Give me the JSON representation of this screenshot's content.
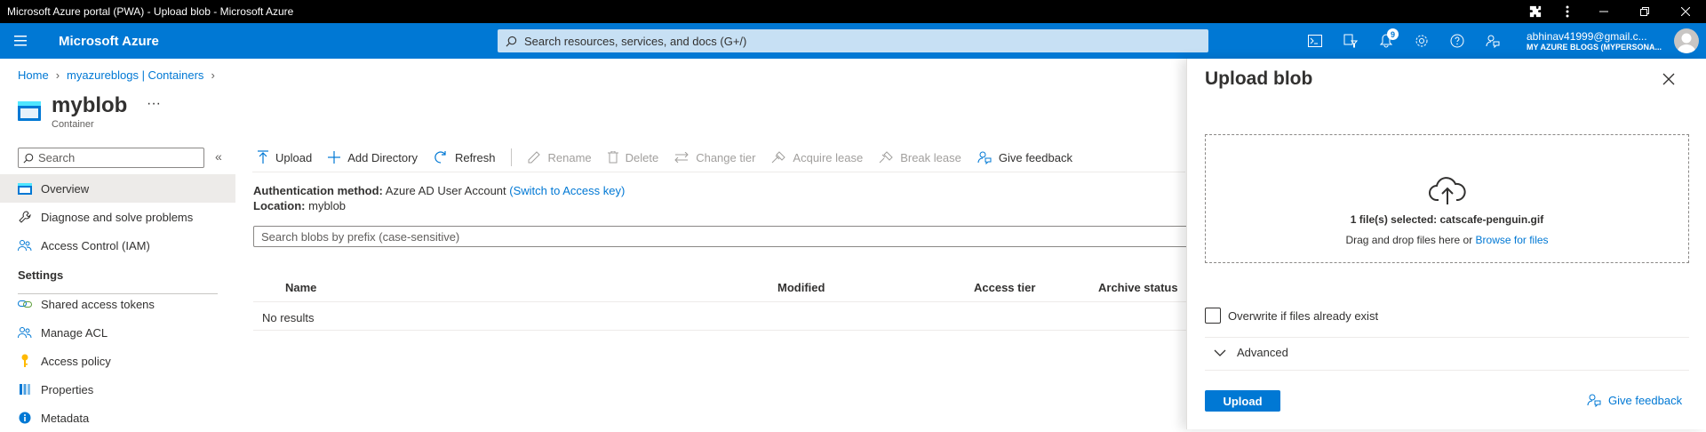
{
  "window": {
    "title": "Microsoft Azure portal (PWA) - Upload blob - Microsoft Azure"
  },
  "topbar": {
    "brand": "Microsoft Azure",
    "search_placeholder": "Search resources, services, and docs (G+/)",
    "notification_count": "9",
    "account_email": "abhinav41999@gmail.c...",
    "account_directory": "MY AZURE BLOGS (MYPERSONA..."
  },
  "breadcrumb": {
    "items": [
      "Home",
      "myazureblogs | Containers"
    ]
  },
  "page": {
    "title": "myblob",
    "subtitle": "Container",
    "more": "···"
  },
  "sidebar": {
    "search_placeholder": "Search",
    "collapse": "«",
    "items": [
      {
        "label": "Overview",
        "icon": "container-icon"
      },
      {
        "label": "Diagnose and solve problems",
        "icon": "wrench-icon"
      },
      {
        "label": "Access Control (IAM)",
        "icon": "people-icon"
      }
    ],
    "section_settings": "Settings",
    "settings_items": [
      {
        "label": "Shared access tokens",
        "icon": "link-icon"
      },
      {
        "label": "Manage ACL",
        "icon": "people-icon"
      },
      {
        "label": "Access policy",
        "icon": "key-icon"
      },
      {
        "label": "Properties",
        "icon": "properties-icon"
      },
      {
        "label": "Metadata",
        "icon": "info-icon"
      }
    ]
  },
  "toolbar": {
    "upload": "Upload",
    "add_directory": "Add Directory",
    "refresh": "Refresh",
    "rename": "Rename",
    "delete": "Delete",
    "change_tier": "Change tier",
    "acquire_lease": "Acquire lease",
    "break_lease": "Break lease",
    "give_feedback": "Give feedback"
  },
  "info": {
    "auth_label": "Authentication method:",
    "auth_value": "Azure AD User Account",
    "auth_switch": "(Switch to Access key)",
    "location_label": "Location:",
    "location_value": "myblob"
  },
  "blob_search": {
    "placeholder": "Search blobs by prefix (case-sensitive)"
  },
  "table": {
    "columns": [
      "Name",
      "Modified",
      "Access tier",
      "Archive status"
    ],
    "empty_text": "No results"
  },
  "panel": {
    "title": "Upload blob",
    "selected_text": "1 file(s) selected: catscafe-penguin.gif",
    "drag_text": "Drag and drop files here  or",
    "browse_link": "Browse for files",
    "overwrite_label": "Overwrite if files already exist",
    "advanced_label": "Advanced",
    "upload_button": "Upload",
    "feedback": "Give feedback"
  },
  "colors": {
    "accent": "#0078d4",
    "titlebar": "#000000",
    "search_bg": "#c7e0f4"
  }
}
